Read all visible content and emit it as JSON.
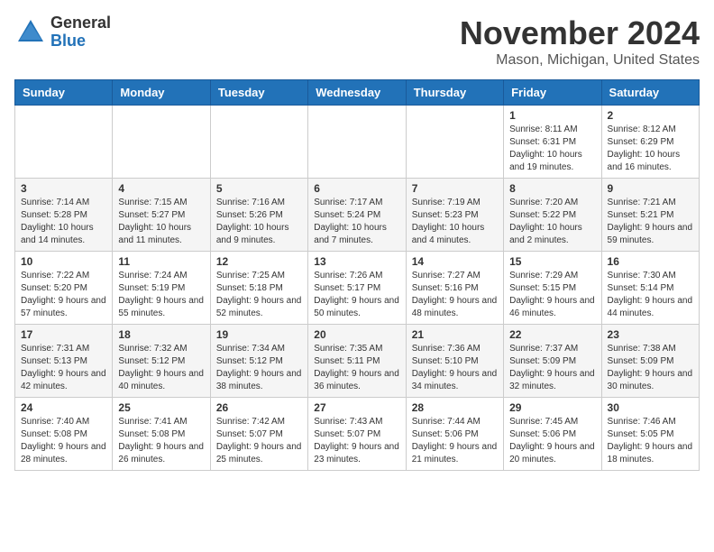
{
  "header": {
    "logo_general": "General",
    "logo_blue": "Blue",
    "month_title": "November 2024",
    "location": "Mason, Michigan, United States"
  },
  "days_of_week": [
    "Sunday",
    "Monday",
    "Tuesday",
    "Wednesday",
    "Thursday",
    "Friday",
    "Saturday"
  ],
  "weeks": [
    [
      {
        "day": "",
        "info": ""
      },
      {
        "day": "",
        "info": ""
      },
      {
        "day": "",
        "info": ""
      },
      {
        "day": "",
        "info": ""
      },
      {
        "day": "",
        "info": ""
      },
      {
        "day": "1",
        "info": "Sunrise: 8:11 AM\nSunset: 6:31 PM\nDaylight: 10 hours and 19 minutes."
      },
      {
        "day": "2",
        "info": "Sunrise: 8:12 AM\nSunset: 6:29 PM\nDaylight: 10 hours and 16 minutes."
      }
    ],
    [
      {
        "day": "3",
        "info": "Sunrise: 7:14 AM\nSunset: 5:28 PM\nDaylight: 10 hours and 14 minutes."
      },
      {
        "day": "4",
        "info": "Sunrise: 7:15 AM\nSunset: 5:27 PM\nDaylight: 10 hours and 11 minutes."
      },
      {
        "day": "5",
        "info": "Sunrise: 7:16 AM\nSunset: 5:26 PM\nDaylight: 10 hours and 9 minutes."
      },
      {
        "day": "6",
        "info": "Sunrise: 7:17 AM\nSunset: 5:24 PM\nDaylight: 10 hours and 7 minutes."
      },
      {
        "day": "7",
        "info": "Sunrise: 7:19 AM\nSunset: 5:23 PM\nDaylight: 10 hours and 4 minutes."
      },
      {
        "day": "8",
        "info": "Sunrise: 7:20 AM\nSunset: 5:22 PM\nDaylight: 10 hours and 2 minutes."
      },
      {
        "day": "9",
        "info": "Sunrise: 7:21 AM\nSunset: 5:21 PM\nDaylight: 9 hours and 59 minutes."
      }
    ],
    [
      {
        "day": "10",
        "info": "Sunrise: 7:22 AM\nSunset: 5:20 PM\nDaylight: 9 hours and 57 minutes."
      },
      {
        "day": "11",
        "info": "Sunrise: 7:24 AM\nSunset: 5:19 PM\nDaylight: 9 hours and 55 minutes."
      },
      {
        "day": "12",
        "info": "Sunrise: 7:25 AM\nSunset: 5:18 PM\nDaylight: 9 hours and 52 minutes."
      },
      {
        "day": "13",
        "info": "Sunrise: 7:26 AM\nSunset: 5:17 PM\nDaylight: 9 hours and 50 minutes."
      },
      {
        "day": "14",
        "info": "Sunrise: 7:27 AM\nSunset: 5:16 PM\nDaylight: 9 hours and 48 minutes."
      },
      {
        "day": "15",
        "info": "Sunrise: 7:29 AM\nSunset: 5:15 PM\nDaylight: 9 hours and 46 minutes."
      },
      {
        "day": "16",
        "info": "Sunrise: 7:30 AM\nSunset: 5:14 PM\nDaylight: 9 hours and 44 minutes."
      }
    ],
    [
      {
        "day": "17",
        "info": "Sunrise: 7:31 AM\nSunset: 5:13 PM\nDaylight: 9 hours and 42 minutes."
      },
      {
        "day": "18",
        "info": "Sunrise: 7:32 AM\nSunset: 5:12 PM\nDaylight: 9 hours and 40 minutes."
      },
      {
        "day": "19",
        "info": "Sunrise: 7:34 AM\nSunset: 5:12 PM\nDaylight: 9 hours and 38 minutes."
      },
      {
        "day": "20",
        "info": "Sunrise: 7:35 AM\nSunset: 5:11 PM\nDaylight: 9 hours and 36 minutes."
      },
      {
        "day": "21",
        "info": "Sunrise: 7:36 AM\nSunset: 5:10 PM\nDaylight: 9 hours and 34 minutes."
      },
      {
        "day": "22",
        "info": "Sunrise: 7:37 AM\nSunset: 5:09 PM\nDaylight: 9 hours and 32 minutes."
      },
      {
        "day": "23",
        "info": "Sunrise: 7:38 AM\nSunset: 5:09 PM\nDaylight: 9 hours and 30 minutes."
      }
    ],
    [
      {
        "day": "24",
        "info": "Sunrise: 7:40 AM\nSunset: 5:08 PM\nDaylight: 9 hours and 28 minutes."
      },
      {
        "day": "25",
        "info": "Sunrise: 7:41 AM\nSunset: 5:08 PM\nDaylight: 9 hours and 26 minutes."
      },
      {
        "day": "26",
        "info": "Sunrise: 7:42 AM\nSunset: 5:07 PM\nDaylight: 9 hours and 25 minutes."
      },
      {
        "day": "27",
        "info": "Sunrise: 7:43 AM\nSunset: 5:07 PM\nDaylight: 9 hours and 23 minutes."
      },
      {
        "day": "28",
        "info": "Sunrise: 7:44 AM\nSunset: 5:06 PM\nDaylight: 9 hours and 21 minutes."
      },
      {
        "day": "29",
        "info": "Sunrise: 7:45 AM\nSunset: 5:06 PM\nDaylight: 9 hours and 20 minutes."
      },
      {
        "day": "30",
        "info": "Sunrise: 7:46 AM\nSunset: 5:05 PM\nDaylight: 9 hours and 18 minutes."
      }
    ]
  ]
}
